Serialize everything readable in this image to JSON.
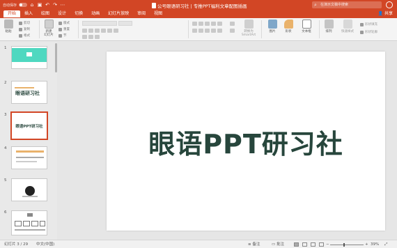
{
  "titlebar": {
    "autosave_label": "自动保存",
    "autosave_state": "off",
    "doc_title": "公号眼语研习社 | 专推PPT福利文章配图插画",
    "search_placeholder": "在演示文稿中搜索",
    "bg_color": "#d24625"
  },
  "tabs": [
    {
      "label": "开始",
      "active": true
    },
    {
      "label": "插入",
      "active": false
    },
    {
      "label": "绘图",
      "active": false
    },
    {
      "label": "设计",
      "active": false
    },
    {
      "label": "切换",
      "active": false
    },
    {
      "label": "动画",
      "active": false
    },
    {
      "label": "幻灯片放映",
      "active": false
    },
    {
      "label": "审阅",
      "active": false
    },
    {
      "label": "视图",
      "active": false
    }
  ],
  "share_label": "共享",
  "ribbon": {
    "paste": "粘贴",
    "cut": "剪切",
    "copy": "复制",
    "format": "格式",
    "new_slide": "新建\n幻灯片",
    "layout": "版式",
    "reset": "重置",
    "section": "节",
    "convert_smartart": "转换为\nSmartArt",
    "picture": "图片",
    "shape": "形状",
    "textbox": "文本框",
    "arrange": "排列",
    "quick_styles": "快速样式",
    "fill": "形状填充",
    "outline": "形状轮廓"
  },
  "slides": [
    {
      "num": "1"
    },
    {
      "num": "2",
      "text": "眼语研习社"
    },
    {
      "num": "3",
      "text": "眼语PPT研习社",
      "selected": true
    },
    {
      "num": "4"
    },
    {
      "num": "5"
    },
    {
      "num": "6"
    }
  ],
  "slide": {
    "title": "眼语PPT研习社",
    "title_color": "#27463c"
  },
  "statusbar": {
    "slide_pos": "幻灯片 3 / 29",
    "language": "中文(中国)",
    "notes": "备注",
    "comments": "批注",
    "zoom": "39%",
    "zoom_fraction": 0.39
  }
}
